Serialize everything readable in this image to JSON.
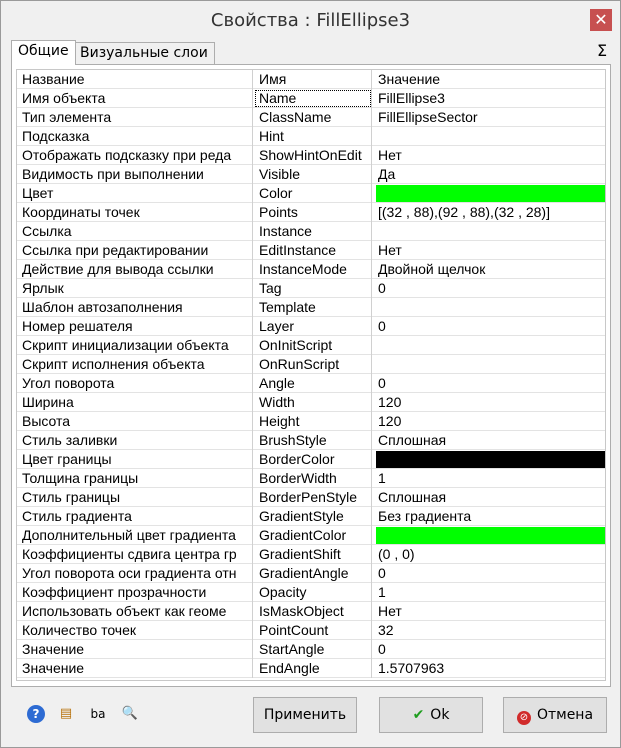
{
  "window": {
    "title": "Свойства :   FillEllipse3",
    "close_glyph": "✕"
  },
  "tabs": [
    {
      "label": "Общие",
      "active": true
    },
    {
      "label": "Визуальные слои",
      "active": false
    }
  ],
  "sigma_glyph": "Σ",
  "colors": {
    "accent_green": "#00ff00",
    "border_black": "#000000",
    "close_red": "#c75050"
  },
  "grid": {
    "headers": [
      "Название",
      "Имя",
      "Значение"
    ],
    "rows": [
      {
        "label": "Имя объекта",
        "name": "Name",
        "value": "FillEllipse3"
      },
      {
        "label": "Тип элемента",
        "name": "ClassName",
        "value": "FillEllipseSector"
      },
      {
        "label": "Подсказка",
        "name": "Hint",
        "value": ""
      },
      {
        "label": "Отображать подсказку при реда",
        "name": "ShowHintOnEdit",
        "value": "Нет"
      },
      {
        "label": "Видимость при выполнении",
        "name": "Visible",
        "value": "Да"
      },
      {
        "label": "Цвет",
        "name": "Color",
        "value": "",
        "swatch": "#00ff00"
      },
      {
        "label": "Координаты точек",
        "name": "Points",
        "value": "[(32 , 88),(92 , 88),(32 , 28)]"
      },
      {
        "label": "Ссылка",
        "name": "Instance",
        "value": ""
      },
      {
        "label": "Ссылка при редактировании",
        "name": "EditInstance",
        "value": "Нет"
      },
      {
        "label": "Действие для вывода ссылки",
        "name": "InstanceMode",
        "value": "Двойной щелчок"
      },
      {
        "label": "Ярлык",
        "name": "Tag",
        "value": "0"
      },
      {
        "label": "Шаблон автозаполнения",
        "name": "Template",
        "value": ""
      },
      {
        "label": "Номер решателя",
        "name": "Layer",
        "value": "0"
      },
      {
        "label": "Скрипт инициализации объекта",
        "name": "OnInitScript",
        "value": ""
      },
      {
        "label": "Скрипт исполнения объекта",
        "name": "OnRunScript",
        "value": ""
      },
      {
        "label": "Угол поворота",
        "name": "Angle",
        "value": "0"
      },
      {
        "label": "Ширина",
        "name": "Width",
        "value": "120"
      },
      {
        "label": "Высота",
        "name": "Height",
        "value": "120"
      },
      {
        "label": "Стиль заливки",
        "name": "BrushStyle",
        "value": "Сплошная"
      },
      {
        "label": "Цвет границы",
        "name": "BorderColor",
        "value": "",
        "swatch": "#000000"
      },
      {
        "label": "Толщина границы",
        "name": "BorderWidth",
        "value": "1"
      },
      {
        "label": "Стиль границы",
        "name": "BorderPenStyle",
        "value": "Сплошная"
      },
      {
        "label": "Стиль градиента",
        "name": "GradientStyle",
        "value": "Без градиента"
      },
      {
        "label": "Дополнительный цвет градиента",
        "name": "GradientColor",
        "value": "",
        "swatch": "#00ff00"
      },
      {
        "label": "Коэффициенты сдвига центра гр",
        "name": "GradientShift",
        "value": "(0 , 0)"
      },
      {
        "label": "Угол поворота оси градиента отн",
        "name": "GradientAngle",
        "value": "0"
      },
      {
        "label": "Коэффициент прозрачности",
        "name": "Opacity",
        "value": "1"
      },
      {
        "label": "Использовать объект как геоме",
        "name": "IsMaskObject",
        "value": "Нет"
      },
      {
        "label": "Количество точек",
        "name": "PointCount",
        "value": "32"
      },
      {
        "label": "Значение",
        "name": "StartAngle",
        "value": "0"
      },
      {
        "label": "Значение",
        "name": "EndAngle",
        "value": "1.5707963"
      }
    ]
  },
  "bottom_icons": [
    {
      "icon": "help-icon",
      "glyph": "?"
    },
    {
      "icon": "grid-edit-icon",
      "glyph": "▤"
    },
    {
      "icon": "sort-icon",
      "glyph": "ba"
    },
    {
      "icon": "search-icon",
      "glyph": "🔍"
    }
  ],
  "buttons": {
    "apply_label": "Применить",
    "ok_label": "Ok",
    "ok_glyph": "✔",
    "cancel_label": "Отмена",
    "cancel_glyph": "⊘"
  }
}
